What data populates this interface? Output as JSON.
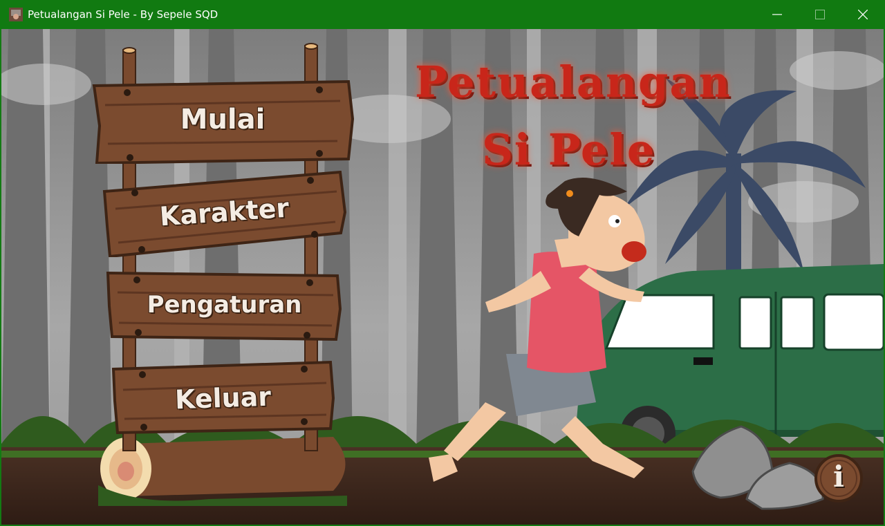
{
  "window": {
    "title": "Petualangan Si Pele - By Sepele SQD",
    "controls": {
      "minimize": "minimize-icon",
      "maximize": "maximize-icon",
      "close": "close-icon"
    },
    "titlebar_color": "#117a11"
  },
  "game": {
    "title_line1": "Petualangan",
    "title_line2": "Si Pele",
    "title_color": "#c8261a"
  },
  "menu": {
    "items": [
      {
        "label": "Mulai"
      },
      {
        "label": "Karakter"
      },
      {
        "label": "Pengaturan"
      },
      {
        "label": "Keluar"
      }
    ]
  },
  "info_button": {
    "label": "i",
    "icon": "info-icon"
  }
}
